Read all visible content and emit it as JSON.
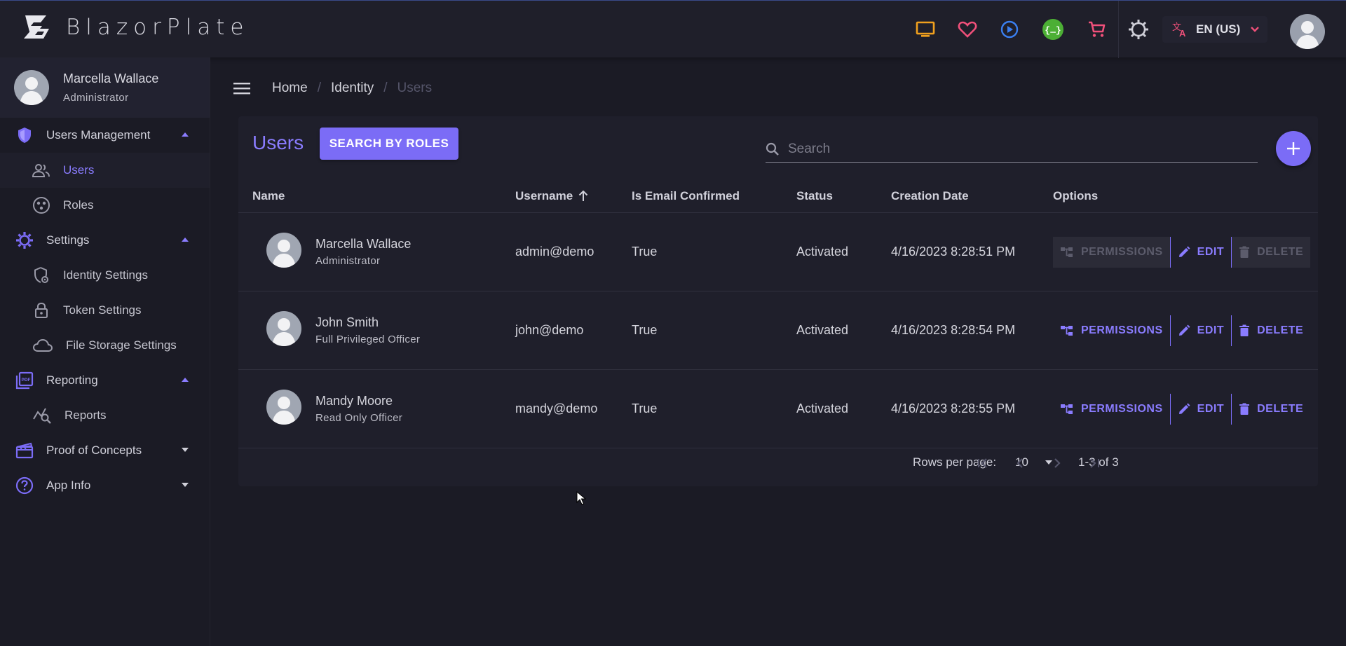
{
  "app": {
    "title": "BlazorPlate"
  },
  "topbar": {
    "icons": [
      "monitor-icon",
      "heart-icon",
      "play-circle-icon",
      "api-icon",
      "cart-icon",
      "settings-icon"
    ],
    "language": "EN (US)"
  },
  "colors": {
    "accent": "#7b6cf6",
    "accent_text": "#8a7cff",
    "background": "#1b1b25",
    "surface": "#1f1f2b"
  },
  "sidebar": {
    "user": {
      "name": "Marcella Wallace",
      "role": "Administrator"
    },
    "groups": [
      {
        "label": "Users Management",
        "icon": "shield-icon",
        "expanded": true,
        "items": [
          {
            "label": "Users",
            "icon": "people-icon",
            "active": true
          },
          {
            "label": "Roles",
            "icon": "roles-icon"
          }
        ]
      },
      {
        "label": "Settings",
        "icon": "gear-icon",
        "expanded": true,
        "items": [
          {
            "label": "Identity Settings",
            "icon": "identity-settings-icon"
          },
          {
            "label": "Token Settings",
            "icon": "lock-icon"
          },
          {
            "label": "File Storage Settings",
            "icon": "cloud-icon"
          }
        ]
      },
      {
        "label": "Reporting",
        "icon": "pdf-icon",
        "expanded": true,
        "items": [
          {
            "label": "Reports",
            "icon": "report-search-icon"
          }
        ]
      },
      {
        "label": "Proof of Concepts",
        "icon": "clapper-icon",
        "expanded": false,
        "items": []
      },
      {
        "label": "App Info",
        "icon": "help-icon",
        "expanded": false,
        "items": []
      }
    ]
  },
  "breadcrumb": [
    "Home",
    "Identity",
    "Users"
  ],
  "main": {
    "title": "Users",
    "search_by_roles": "SEARCH BY ROLES",
    "search_placeholder": "Search",
    "columns": [
      "Name",
      "Username",
      "Is Email Confirmed",
      "Status",
      "Creation Date",
      "Options"
    ],
    "sort": {
      "column": "Username",
      "direction": "ascending"
    },
    "rows": [
      {
        "name": "Marcella Wallace",
        "role": "Administrator",
        "username": "admin@demo",
        "email_confirmed": "True",
        "status": "Activated",
        "created": "4/16/2023 8:28:51 PM",
        "actions_enabled": false
      },
      {
        "name": "John Smith",
        "role": "Full Privileged Officer",
        "username": "john@demo",
        "email_confirmed": "True",
        "status": "Activated",
        "created": "4/16/2023 8:28:54 PM",
        "actions_enabled": true
      },
      {
        "name": "Mandy Moore",
        "role": "Read Only Officer",
        "username": "mandy@demo",
        "email_confirmed": "True",
        "status": "Activated",
        "created": "4/16/2023 8:28:55 PM",
        "actions_enabled": true
      }
    ],
    "actions": {
      "permissions": "PERMISSIONS",
      "edit": "EDIT",
      "delete": "DELETE"
    },
    "pager": {
      "rows_per_page_label": "Rows per page:",
      "rows_per_page": "10",
      "range": "1-3 of 3"
    }
  }
}
